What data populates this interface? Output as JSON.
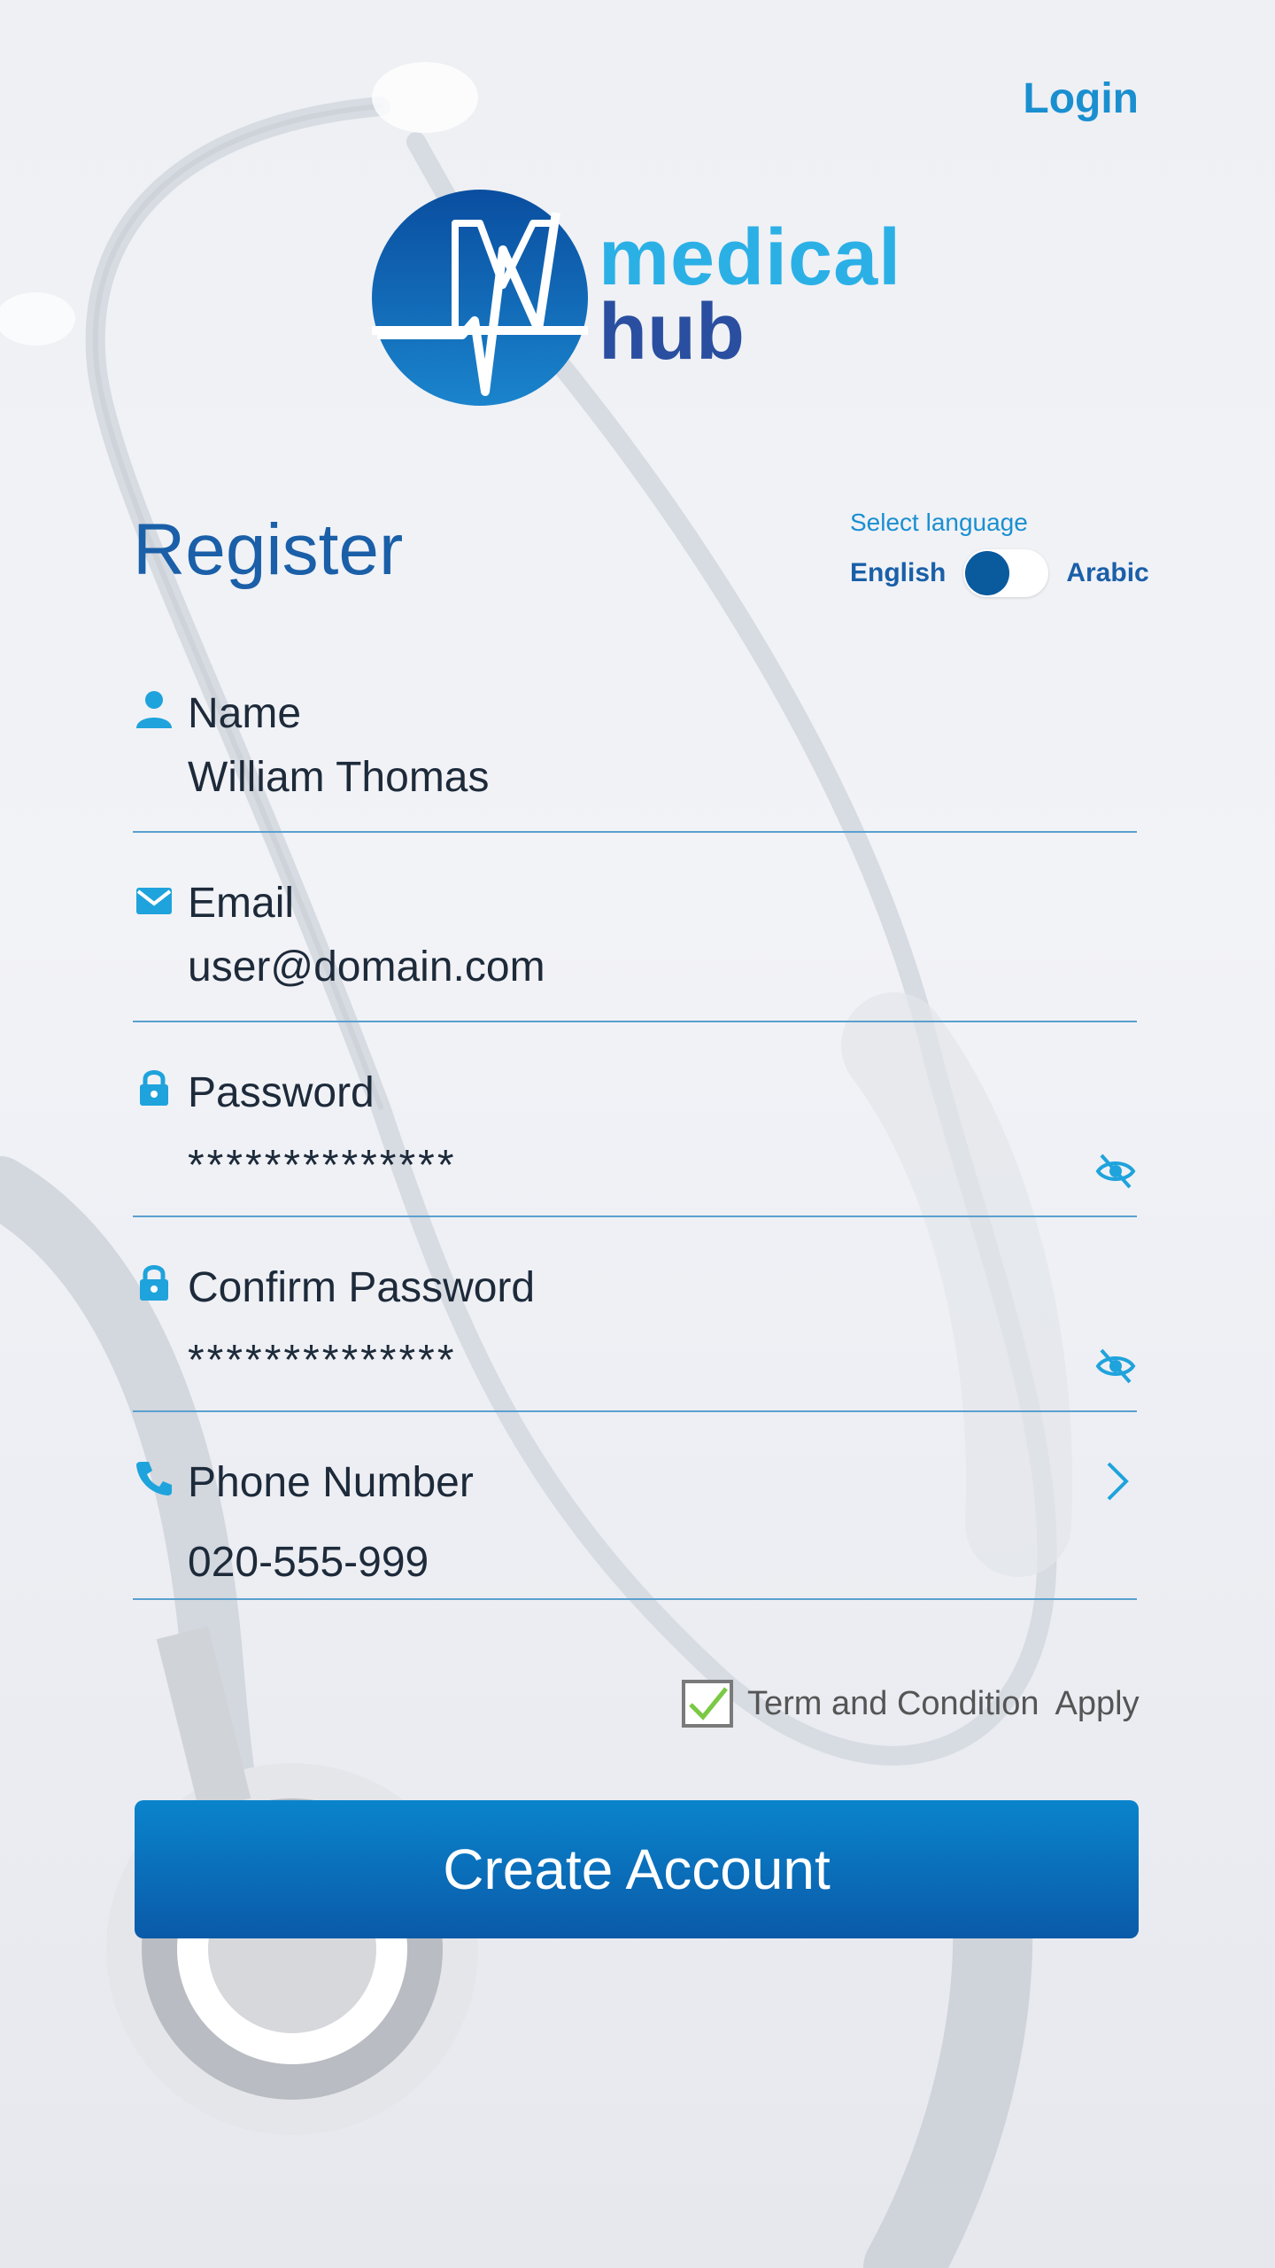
{
  "header": {
    "login_label": "Login"
  },
  "logo": {
    "word1": "medical",
    "word2": "hub"
  },
  "title": "Register",
  "language": {
    "caption": "Select language",
    "option_left": "English",
    "option_right": "Arabic",
    "selected": "English"
  },
  "form": {
    "name": {
      "label": "Name",
      "value": "William Thomas",
      "icon": "person-icon"
    },
    "email": {
      "label": "Email",
      "value": "user@domain.com",
      "icon": "mail-icon"
    },
    "password": {
      "label": "Password",
      "value": "**************",
      "icon": "lock-icon",
      "trailing_icon": "eye-slash-icon"
    },
    "confirm_password": {
      "label": "Confirm Password",
      "value": "**************",
      "icon": "lock-icon",
      "trailing_icon": "eye-slash-icon"
    },
    "phone": {
      "label": "Phone Number",
      "value": "020-555-999",
      "icon": "phone-icon",
      "trailing_icon": "chevron-right-icon"
    }
  },
  "terms": {
    "text": "Term and Condition",
    "apply": "Apply",
    "checked": true
  },
  "cta": {
    "label": "Create Account"
  },
  "colors": {
    "primary": "#0a5aa8",
    "accent": "#1a8fd0",
    "divider": "#5aa0cf",
    "check": "#7ac943"
  }
}
